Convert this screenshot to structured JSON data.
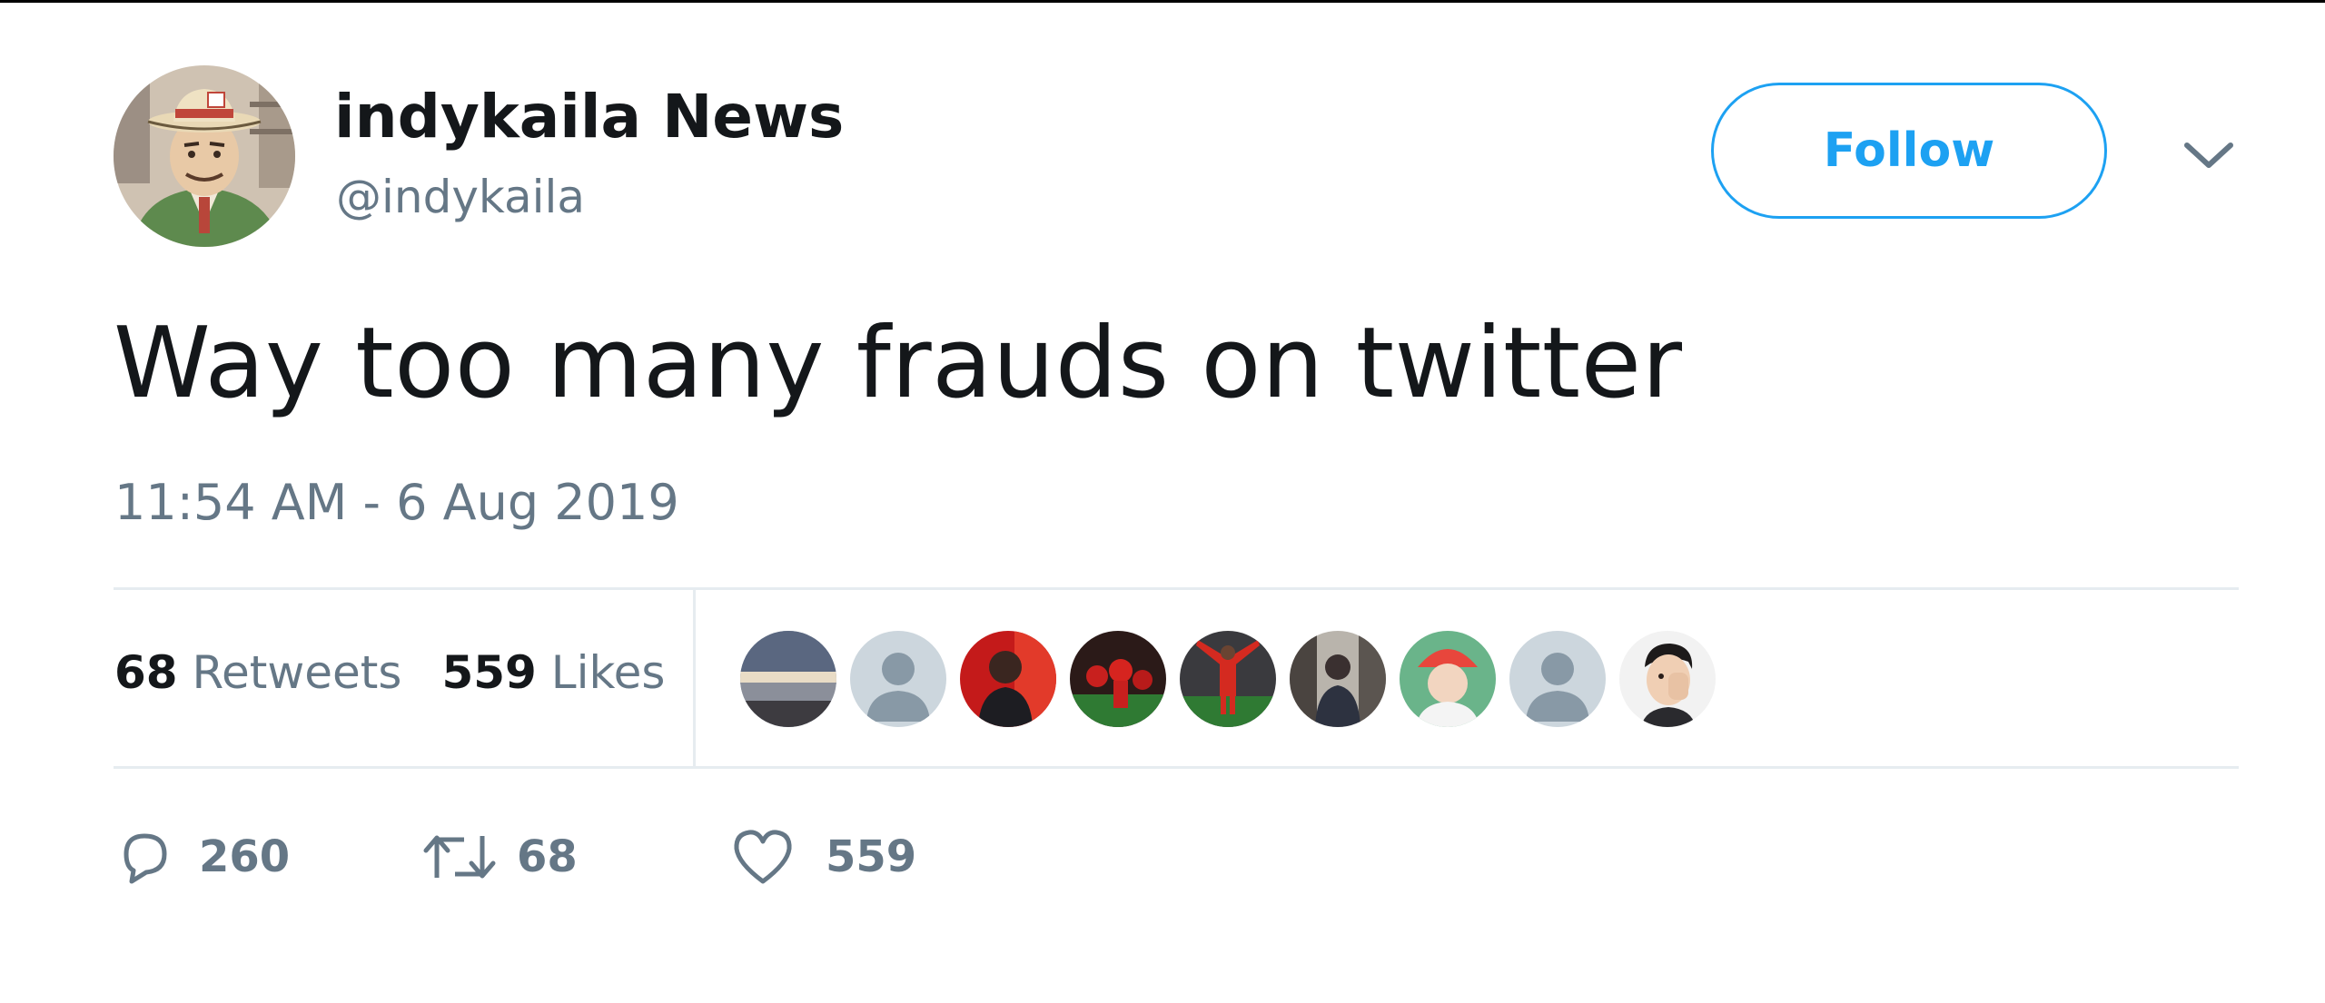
{
  "user": {
    "display_name": "indykaila News",
    "handle": "@indykaila",
    "avatar_icon": "cartoon-man-avatar"
  },
  "follow_button": {
    "label": "Follow",
    "color": "#1da1f2"
  },
  "menu_icon": "chevron-down-icon",
  "tweet": {
    "text": "Way too many frauds on twitter",
    "timestamp": "11:54 AM - 6 Aug 2019"
  },
  "stats": {
    "retweets_count": "68",
    "retweets_label": "Retweets",
    "likes_count": "559",
    "likes_label": "Likes"
  },
  "likers": [
    "landscape-photo-avatar",
    "default-avatar",
    "person-red-avatar",
    "football-crowd-avatar",
    "player-celebrating-avatar",
    "person-photo-avatar",
    "colorful-avatar",
    "default-avatar",
    "person-face-avatar"
  ],
  "actions": {
    "reply_icon": "reply-icon",
    "reply_count": "260",
    "retweet_icon": "retweet-icon",
    "retweet_count": "68",
    "like_icon": "heart-icon",
    "like_count": "559"
  },
  "colors": {
    "text_primary": "#14171a",
    "text_secondary": "#657786",
    "accent": "#1da1f2",
    "divider": "#e6ecf0"
  }
}
